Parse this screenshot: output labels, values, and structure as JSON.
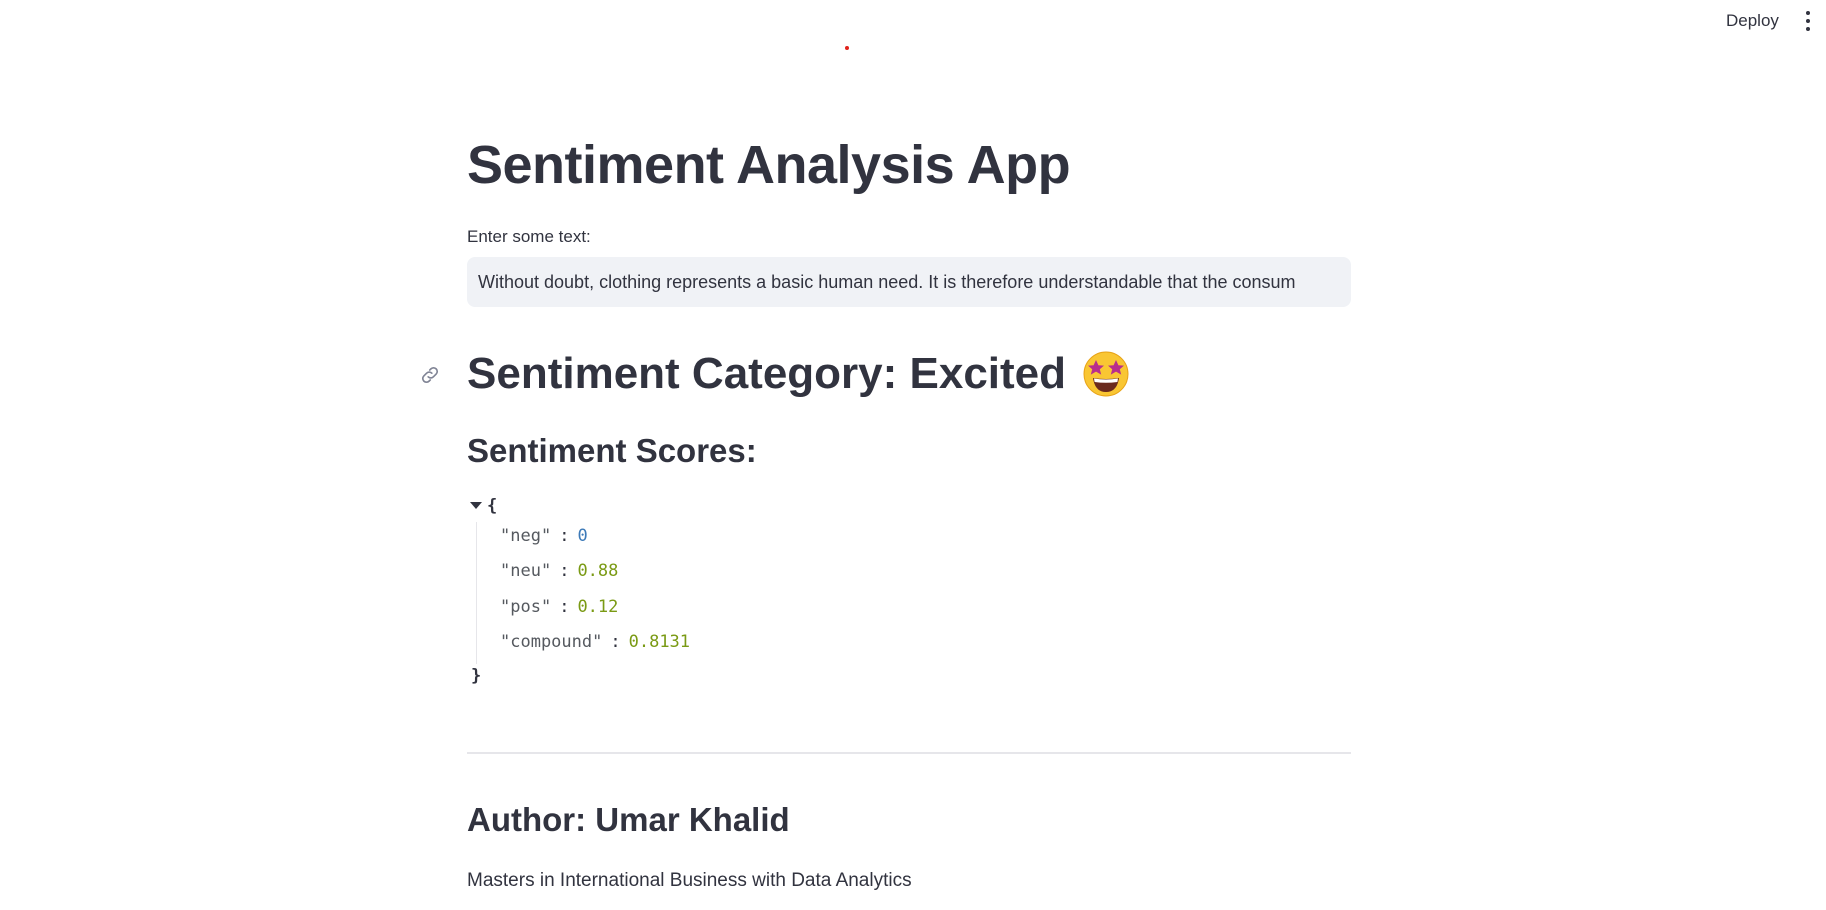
{
  "header": {
    "deploy_label": "Deploy",
    "menu_icon": "more-vertical-icon",
    "status_color": "#e0231b"
  },
  "main": {
    "title": "Sentiment Analysis App",
    "input": {
      "label": "Enter some text:",
      "value": "Without doubt, clothing represents a basic human need. It is therefore understandable that the consum"
    },
    "category": {
      "text": "Sentiment Category: Excited",
      "emoji_icon": "star-struck-emoji-icon",
      "link_icon": "link-icon"
    },
    "scores_heading": "Sentiment Scores:",
    "scores": [
      {
        "key": "\"neg\"",
        "value": "0",
        "kind": "int"
      },
      {
        "key": "\"neu\"",
        "value": "0.88",
        "kind": "float"
      },
      {
        "key": "\"pos\"",
        "value": "0.12",
        "kind": "float"
      },
      {
        "key": "\"compound\"",
        "value": "0.8131",
        "kind": "float"
      }
    ],
    "json_open": "{",
    "json_close": "}",
    "author_heading": "Author: Umar Khalid",
    "author_subtitle": "Masters in International Business with Data Analytics"
  },
  "colors": {
    "text": "#31333f",
    "input_bg": "#f0f2f6",
    "json_int": "#3d7ab8",
    "json_float": "#7a9a14"
  }
}
